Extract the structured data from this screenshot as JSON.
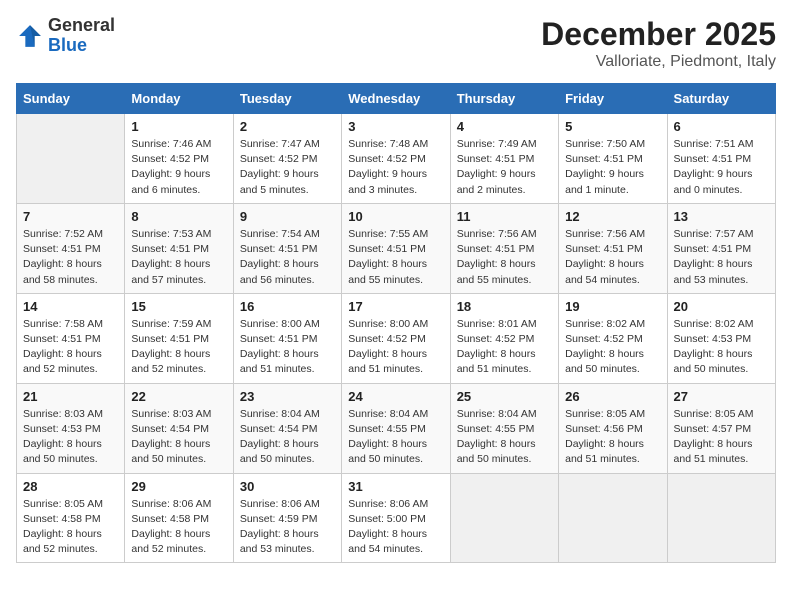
{
  "header": {
    "logo_general": "General",
    "logo_blue": "Blue",
    "month_title": "December 2025",
    "location": "Valloriate, Piedmont, Italy"
  },
  "calendar": {
    "days_of_week": [
      "Sunday",
      "Monday",
      "Tuesday",
      "Wednesday",
      "Thursday",
      "Friday",
      "Saturday"
    ],
    "weeks": [
      [
        {
          "day": "",
          "info": ""
        },
        {
          "day": "1",
          "info": "Sunrise: 7:46 AM\nSunset: 4:52 PM\nDaylight: 9 hours\nand 6 minutes."
        },
        {
          "day": "2",
          "info": "Sunrise: 7:47 AM\nSunset: 4:52 PM\nDaylight: 9 hours\nand 5 minutes."
        },
        {
          "day": "3",
          "info": "Sunrise: 7:48 AM\nSunset: 4:52 PM\nDaylight: 9 hours\nand 3 minutes."
        },
        {
          "day": "4",
          "info": "Sunrise: 7:49 AM\nSunset: 4:51 PM\nDaylight: 9 hours\nand 2 minutes."
        },
        {
          "day": "5",
          "info": "Sunrise: 7:50 AM\nSunset: 4:51 PM\nDaylight: 9 hours\nand 1 minute."
        },
        {
          "day": "6",
          "info": "Sunrise: 7:51 AM\nSunset: 4:51 PM\nDaylight: 9 hours\nand 0 minutes."
        }
      ],
      [
        {
          "day": "7",
          "info": "Sunrise: 7:52 AM\nSunset: 4:51 PM\nDaylight: 8 hours\nand 58 minutes."
        },
        {
          "day": "8",
          "info": "Sunrise: 7:53 AM\nSunset: 4:51 PM\nDaylight: 8 hours\nand 57 minutes."
        },
        {
          "day": "9",
          "info": "Sunrise: 7:54 AM\nSunset: 4:51 PM\nDaylight: 8 hours\nand 56 minutes."
        },
        {
          "day": "10",
          "info": "Sunrise: 7:55 AM\nSunset: 4:51 PM\nDaylight: 8 hours\nand 55 minutes."
        },
        {
          "day": "11",
          "info": "Sunrise: 7:56 AM\nSunset: 4:51 PM\nDaylight: 8 hours\nand 55 minutes."
        },
        {
          "day": "12",
          "info": "Sunrise: 7:56 AM\nSunset: 4:51 PM\nDaylight: 8 hours\nand 54 minutes."
        },
        {
          "day": "13",
          "info": "Sunrise: 7:57 AM\nSunset: 4:51 PM\nDaylight: 8 hours\nand 53 minutes."
        }
      ],
      [
        {
          "day": "14",
          "info": "Sunrise: 7:58 AM\nSunset: 4:51 PM\nDaylight: 8 hours\nand 52 minutes."
        },
        {
          "day": "15",
          "info": "Sunrise: 7:59 AM\nSunset: 4:51 PM\nDaylight: 8 hours\nand 52 minutes."
        },
        {
          "day": "16",
          "info": "Sunrise: 8:00 AM\nSunset: 4:51 PM\nDaylight: 8 hours\nand 51 minutes."
        },
        {
          "day": "17",
          "info": "Sunrise: 8:00 AM\nSunset: 4:52 PM\nDaylight: 8 hours\nand 51 minutes."
        },
        {
          "day": "18",
          "info": "Sunrise: 8:01 AM\nSunset: 4:52 PM\nDaylight: 8 hours\nand 51 minutes."
        },
        {
          "day": "19",
          "info": "Sunrise: 8:02 AM\nSunset: 4:52 PM\nDaylight: 8 hours\nand 50 minutes."
        },
        {
          "day": "20",
          "info": "Sunrise: 8:02 AM\nSunset: 4:53 PM\nDaylight: 8 hours\nand 50 minutes."
        }
      ],
      [
        {
          "day": "21",
          "info": "Sunrise: 8:03 AM\nSunset: 4:53 PM\nDaylight: 8 hours\nand 50 minutes."
        },
        {
          "day": "22",
          "info": "Sunrise: 8:03 AM\nSunset: 4:54 PM\nDaylight: 8 hours\nand 50 minutes."
        },
        {
          "day": "23",
          "info": "Sunrise: 8:04 AM\nSunset: 4:54 PM\nDaylight: 8 hours\nand 50 minutes."
        },
        {
          "day": "24",
          "info": "Sunrise: 8:04 AM\nSunset: 4:55 PM\nDaylight: 8 hours\nand 50 minutes."
        },
        {
          "day": "25",
          "info": "Sunrise: 8:04 AM\nSunset: 4:55 PM\nDaylight: 8 hours\nand 50 minutes."
        },
        {
          "day": "26",
          "info": "Sunrise: 8:05 AM\nSunset: 4:56 PM\nDaylight: 8 hours\nand 51 minutes."
        },
        {
          "day": "27",
          "info": "Sunrise: 8:05 AM\nSunset: 4:57 PM\nDaylight: 8 hours\nand 51 minutes."
        }
      ],
      [
        {
          "day": "28",
          "info": "Sunrise: 8:05 AM\nSunset: 4:58 PM\nDaylight: 8 hours\nand 52 minutes."
        },
        {
          "day": "29",
          "info": "Sunrise: 8:06 AM\nSunset: 4:58 PM\nDaylight: 8 hours\nand 52 minutes."
        },
        {
          "day": "30",
          "info": "Sunrise: 8:06 AM\nSunset: 4:59 PM\nDaylight: 8 hours\nand 53 minutes."
        },
        {
          "day": "31",
          "info": "Sunrise: 8:06 AM\nSunset: 5:00 PM\nDaylight: 8 hours\nand 54 minutes."
        },
        {
          "day": "",
          "info": ""
        },
        {
          "day": "",
          "info": ""
        },
        {
          "day": "",
          "info": ""
        }
      ]
    ]
  }
}
